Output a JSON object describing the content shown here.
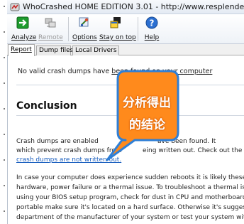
{
  "window": {
    "title": "WhoCrashed HOME EDITION 3.01 - http://www.resplendence.com"
  },
  "toolbar": {
    "analyze": "Analyze",
    "remote": "Remote",
    "options": "Options",
    "stay_on_top": "Stay on top",
    "help": "Help"
  },
  "tabs": {
    "report": "Report",
    "dump_files": "Dump files",
    "local_drivers": "Local Drivers"
  },
  "report": {
    "no_dumps_pre": "No valid crash dumps have ",
    "no_dumps_link": "been found on your computer",
    "conclusion_heading": "Conclusion",
    "para1": {
      "l1a": "Crash dumps are enabled",
      "l1b": "ave been found. It",
      "l2a": "which prevent crash dumps from",
      "l2b": "eing written out. Check out the follow",
      "link": "crash dumps are not written out."
    },
    "para2": {
      "l1": "In case your computer does experience sudden reboots it is likely these",
      "l2": "hardware, power failure or a thermal issue. To troubleshoot a thermal is",
      "l3": "using your BIOS setup program, check for dust in CPU and motherboard",
      "l4": "portable make sure it's located on a hard surface. Otherwise it's sugges",
      "l5": "department of the manufacturer of your system or test your system with"
    }
  },
  "callout": {
    "line1": "分析得出",
    "line2": "的结论"
  },
  "colors": {
    "callout_fill": "#ff8a1c",
    "callout_stroke": "#2f7fd6",
    "link": "#1a5fbf"
  }
}
